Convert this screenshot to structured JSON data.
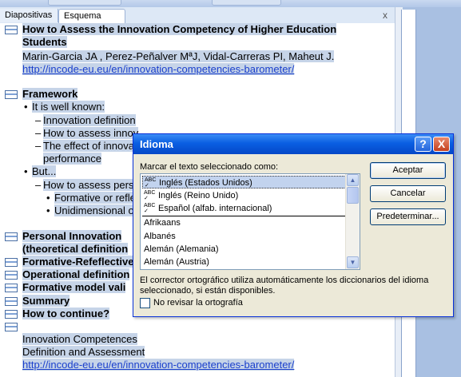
{
  "tabs": {
    "slides": "Diapositivas",
    "outline": "Esquema",
    "close_glyph": "x"
  },
  "outline": {
    "slide1_title_line1": "How to Assess the Innovation Competency of Higher Education",
    "slide1_title_line2": "Students",
    "slide1_authors": "Marin-Garcia JA , Perez-Peñalver MªJ, Vidal-Carreras PI, Maheut J.",
    "slide1_link": "http://incode-eu.eu/en/innovation-competencies-barometer/",
    "slide2_title": "Framework",
    "slide2_b1": "It is well known:",
    "slide2_b1_1": "Innovation definition",
    "slide2_b1_2": "How to assess innov",
    "slide2_b1_3a": "The effect of innova",
    "slide2_b1_3b": "performance",
    "slide2_b2": "But...",
    "slide2_b2_1": "How to assess pers",
    "slide2_b2_1_1": "Formative or refle",
    "slide2_b2_1_2": "Unidimensional o",
    "slide3_title_line1": "Personal Innovation",
    "slide3_title_line2": "(theoretical definition",
    "slide4_title": "Formative-Refeflective",
    "slide5_title": "Operational definition",
    "slide6_title": "Formative model vali",
    "slide7_title": "Summary",
    "slide8_title": "How to continue?",
    "slide9_line1": "Innovation Competences",
    "slide9_line2": "Definition and Assessment",
    "slide9_link": "http://incode-eu.eu/en/innovation-competencies-barometer/"
  },
  "dialog": {
    "title": "Idioma",
    "help": "?",
    "close": "X",
    "label": "Marcar el texto seleccionado como:",
    "items": [
      "Inglés (Estados Unidos)",
      "Inglés (Reino Unido)",
      "Español (alfab. internacional)",
      "Afrikaans",
      "Albanés",
      "Alemán (Alemania)",
      "Alemán (Austria)"
    ],
    "buttons": {
      "ok": "Aceptar",
      "cancel": "Cancelar",
      "default": "Predeterminar..."
    },
    "note": "El corrector ortográfico utiliza automáticamente los diccionarios del idioma seleccionado, si están disponibles.",
    "checkbox_label": "No revisar la ortografía",
    "checkbox_checked": false
  },
  "colors": {
    "selection": "#c6d4e8",
    "title_bar": "#0a5fe2",
    "link": "#1a3fcc"
  }
}
